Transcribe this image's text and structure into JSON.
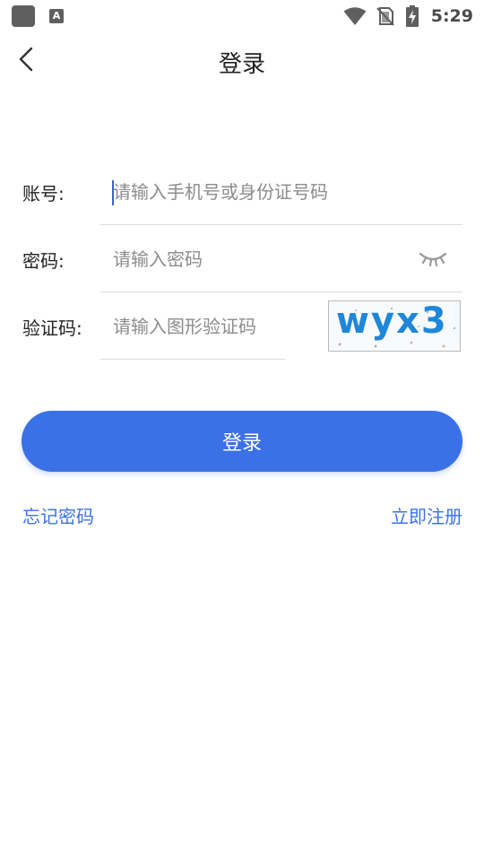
{
  "status_bar": {
    "time": "5:29",
    "notification_icon_letter": "A",
    "icons": [
      "app-icon",
      "accessibility-a-icon",
      "wifi-icon",
      "no-sim-icon",
      "battery-charging-icon"
    ]
  },
  "header": {
    "title": "登录",
    "back_icon": "chevron-left-icon"
  },
  "form": {
    "account": {
      "label": "账号:",
      "placeholder": "请输入手机号或身份证号码",
      "value": ""
    },
    "password": {
      "label": "密码:",
      "placeholder": "请输入密码",
      "value": "",
      "toggle_icon": "eye-closed-icon"
    },
    "captcha": {
      "label": "验证码:",
      "placeholder": "请输入图形验证码",
      "value": "",
      "image_text": "wyx3"
    }
  },
  "login_button": {
    "label": "登录"
  },
  "links": {
    "forgot_password": "忘记密码",
    "register": "立即注册"
  },
  "colors": {
    "accent": "#3b71e6",
    "captcha_text": "#1f86d8",
    "divider": "#dcdcdc",
    "placeholder": "#8c8c8c"
  }
}
